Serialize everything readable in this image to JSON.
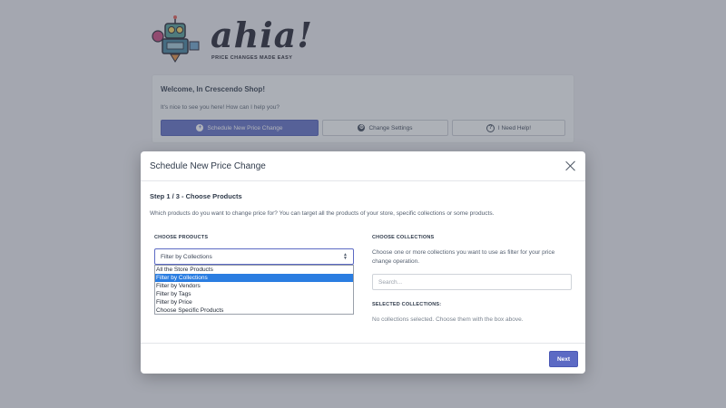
{
  "brand": {
    "logo_text": "ahia!",
    "tagline": "PRICE CHANGES MADE EASY"
  },
  "welcome": {
    "title": "Welcome, In Crescendo Shop!",
    "subtitle": "It's nice to see you here! How can I help you?",
    "buttons": {
      "schedule": "Schedule New Price Change",
      "settings": "Change Settings",
      "help": "I Need Help!"
    }
  },
  "modal": {
    "title": "Schedule New Price Change",
    "step_title": "Step 1 / 3 - Choose Products",
    "step_description": "Which products do you want to change price for? You can target all the products of your store, specific collections or some products.",
    "choose_products": {
      "label": "CHOOSE PRODUCTS",
      "selected": "Filter by Collections",
      "options": [
        "All the Store Products",
        "Filter by Collections",
        "Filter by Vendors",
        "Filter by Tags",
        "Filter by Price",
        "Choose Specific Products"
      ]
    },
    "choose_collections": {
      "label": "CHOOSE COLLECTIONS",
      "description": "Choose one or more collections you want to use as filter for your price change operation.",
      "search_placeholder": "Search..."
    },
    "selected_collections": {
      "label": "SELECTED COLLECTIONS:",
      "empty_text": "No collections selected. Choose them with the box above."
    },
    "next_label": "Next"
  },
  "colors": {
    "accent": "#5c6ac4",
    "highlight": "#2a7de1"
  }
}
